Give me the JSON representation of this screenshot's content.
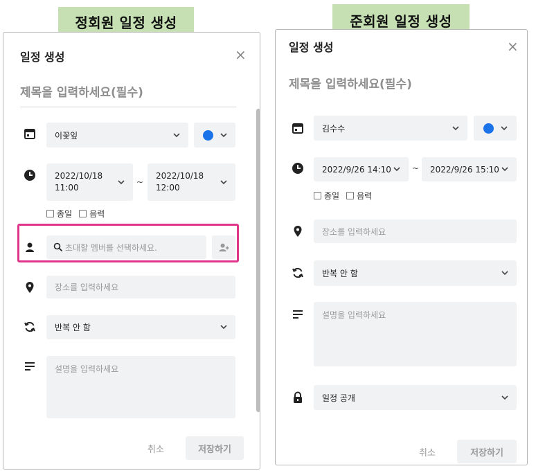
{
  "labels": {
    "left_tag": "정회원 일정 생성",
    "right_tag": "준회원 일정 생성"
  },
  "left": {
    "dialog_title": "일정 생성",
    "close": "×",
    "title_placeholder": "제목을 입력하세요(필수)",
    "calendar_select": "이꽃잎",
    "color": "#1a73e8",
    "start_datetime": "2022/10/18 11:00",
    "end_datetime": "2022/10/18 12:00",
    "tilde": "~",
    "all_day_label": "종일",
    "lunar_label": "음력",
    "invite_placeholder": "초대할 멤버를 선택하세요.",
    "location_placeholder": "장소를 입력하세요",
    "repeat_select": "반복 안 함",
    "description_placeholder": "설명을 입력하세요",
    "cancel_label": "취소",
    "save_label": "저장하기"
  },
  "right": {
    "dialog_title": "일정 생성",
    "close": "×",
    "title_placeholder": "제목을 입력하세요(필수)",
    "calendar_select": "김수수",
    "color": "#1a73e8",
    "start_datetime": "2022/9/26 14:10",
    "end_datetime": "2022/9/26 15:10",
    "tilde": "~",
    "all_day_label": "종일",
    "lunar_label": "음력",
    "location_placeholder": "장소를 입력하세요",
    "repeat_select": "반복 안 함",
    "description_placeholder": "설명을 입력하세요",
    "visibility_select": "일정 공개",
    "cancel_label": "취소",
    "save_label": "저장하기"
  },
  "accent": {
    "highlight": "#e0358a",
    "tag_bg": "#c6e0b4"
  }
}
